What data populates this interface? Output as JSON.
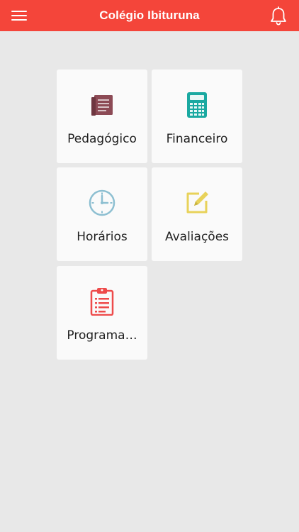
{
  "header": {
    "title": "Colégio Ibituruna",
    "menu_icon": "hamburger-menu-icon",
    "notification_icon": "bell-icon"
  },
  "tiles": [
    {
      "label": "Pedagógico",
      "icon": "book-icon",
      "color": "#8c4a55"
    },
    {
      "label": "Financeiro",
      "icon": "calculator-icon",
      "color": "#1aa9a1"
    },
    {
      "label": "Horários",
      "icon": "clock-icon",
      "color": "#8dbfd1"
    },
    {
      "label": "Avaliações",
      "icon": "edit-icon",
      "color": "#e8d25a"
    },
    {
      "label": "Programa…",
      "icon": "clipboard-icon",
      "color": "#ee4b4b"
    }
  ],
  "colors": {
    "header_bg": "#f4453a",
    "page_bg": "#e8e8e8",
    "tile_bg": "#fafafa"
  }
}
